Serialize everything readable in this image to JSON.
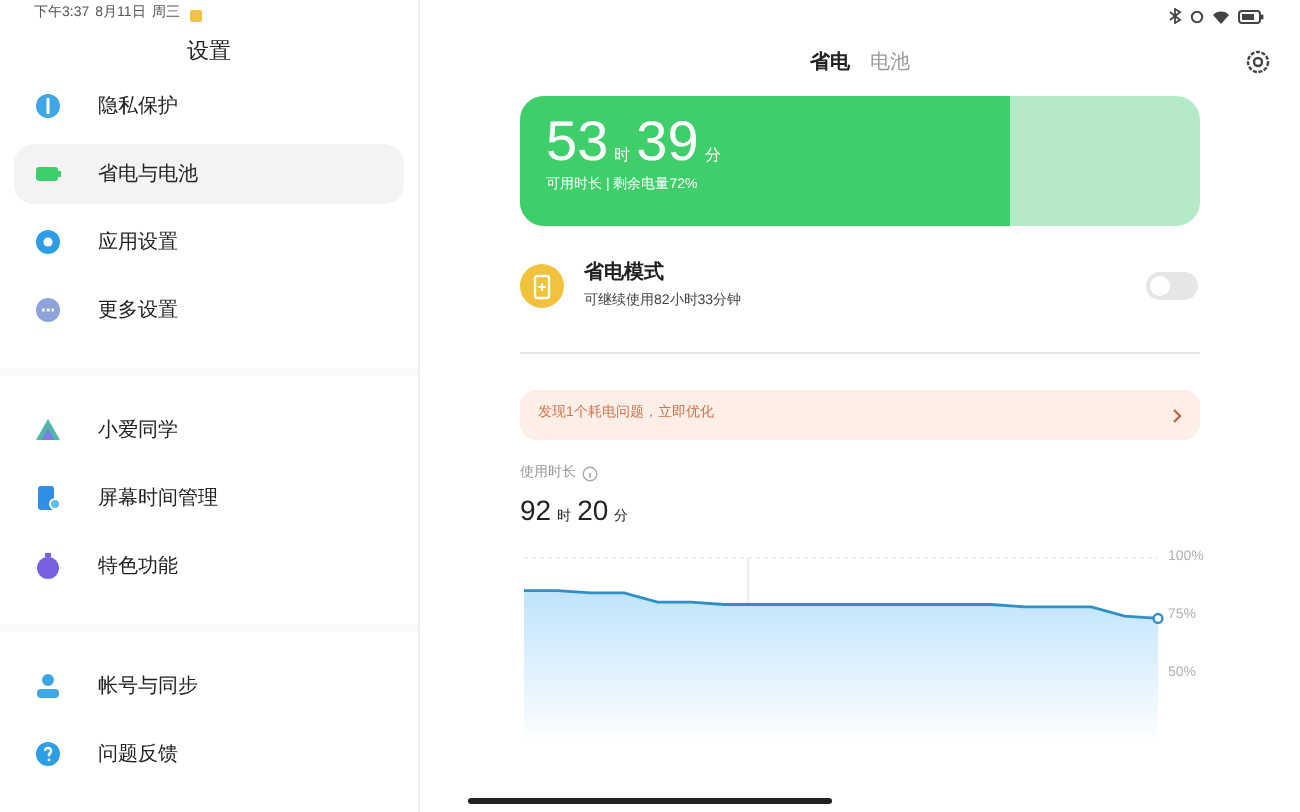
{
  "status_bar": {
    "time": "下午3:37",
    "date": "8月11日",
    "weekday": "周三"
  },
  "sidebar": {
    "title": "设置",
    "groups": [
      [
        {
          "label": "隐私保护",
          "selected": false
        },
        {
          "label": "省电与电池",
          "selected": true
        },
        {
          "label": "应用设置",
          "selected": false
        },
        {
          "label": "更多设置",
          "selected": false
        }
      ],
      [
        {
          "label": "小爱同学",
          "selected": false
        },
        {
          "label": "屏幕时间管理",
          "selected": false
        },
        {
          "label": "特色功能",
          "selected": false
        }
      ],
      [
        {
          "label": "帐号与同步",
          "selected": false
        },
        {
          "label": "问题反馈",
          "selected": false
        }
      ]
    ]
  },
  "tabs": [
    {
      "label": "省电",
      "selected": true
    },
    {
      "label": "电池",
      "selected": false
    }
  ],
  "battery_card": {
    "hours": "53",
    "hours_unit": "时",
    "minutes": "39",
    "minutes_unit": "分",
    "subtitle": "可用时长 | 剩余电量72%",
    "level": 0.72
  },
  "power_saving": {
    "title": "省电模式",
    "subtitle": "可继续使用82小时33分钟",
    "on": false
  },
  "alert": {
    "text": "发现1个耗电问题，立即优化"
  },
  "usage": {
    "label": "使用时长",
    "hours": "92",
    "hours_unit": "时",
    "minutes": "20",
    "minutes_unit": "分",
    "chart_data": {
      "type": "area",
      "categories": [
        null,
        null,
        null,
        null,
        null,
        null,
        null,
        null,
        null,
        null,
        null,
        null,
        null,
        null,
        null,
        null,
        null,
        null,
        null,
        null
      ],
      "ylim": [
        20,
        100
      ],
      "yticks": [
        {
          "value": 100,
          "label": "100%"
        },
        {
          "value": 75,
          "label": "75%"
        },
        {
          "value": 50,
          "label": "50%"
        }
      ],
      "series": [
        {
          "color": "#2f8fc6",
          "values": [
            86,
            86,
            85,
            85,
            81,
            81,
            80,
            80,
            80,
            80,
            80,
            80,
            80,
            80,
            80,
            79,
            79,
            79,
            75,
            74
          ]
        }
      ]
    }
  }
}
